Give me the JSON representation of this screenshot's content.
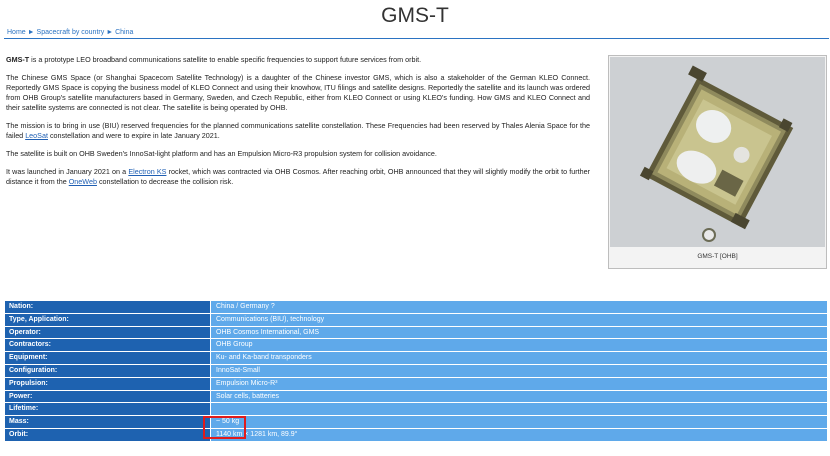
{
  "page": {
    "title": "GMS-T",
    "breadcrumb": [
      "Home",
      "Spacecraft by country",
      "China"
    ],
    "breadcrumb_separator": "►"
  },
  "intro": {
    "p1_bold": "GMS-T",
    "p1_rest": " is a prototype LEO broadband communications satellite to enable specific frequencies to support future services from orbit.",
    "p2": "The Chinese GMS Space (or Shanghai Spacecom Satellite Technology) is a daughter of the Chinese investor GMS, which is also a stakeholder of the German KLEO Connect. Reportedly GMS Space is copying the business model of KLEO Connect and using their knowhow, ITU filings and satellite designs. Reportedly the satellite and its launch was ordered from OHB Group's satellite manufacturers based in Germany, Sweden, and Czech Republic, either from KLEO Connect or using KLEO's funding. How GMS and KLEO Connect and their satellite systems are connected is not clear. The satellite is being operated by OHB.",
    "p3_a": "The mission is to bring in use (BIU) reserved frequencies for the planned communications satellite constellation. These Frequencies had been reserved by Thales Alenia Space for the failed ",
    "p3_link": "LeoSat",
    "p3_b": " constellation and were to expire in late January 2021.",
    "p4": "The satellite is built on OHB Sweden's InnoSat-light platform and has an Empulsion Micro-R3 propulsion system for collision avoidance.",
    "p5_a": "It was launched in January 2021 on a ",
    "p5_link1": "Electron KS",
    "p5_b": " rocket, which was contracted via OHB Cosmos. After reaching orbit, OHB announced that they will slightly modify the orbit to further distance it from the ",
    "p5_link2": "OneWeb",
    "p5_c": " constellation to decrease the collision risk."
  },
  "figure": {
    "caption": "GMS-T [OHB]"
  },
  "specs": [
    {
      "label": "Nation:",
      "value": "China / Germany ?"
    },
    {
      "label": "Type, Application:",
      "value": "Communications (BIU), technology"
    },
    {
      "label": "Operator:",
      "value": "OHB Cosmos International, GMS"
    },
    {
      "label": "Contractors:",
      "value": "OHB Group"
    },
    {
      "label": "Equipment:",
      "value": "Ku- and Ka-band transponders"
    },
    {
      "label": "Configuration:",
      "value": "InnoSat-Small"
    },
    {
      "label": "Propulsion:",
      "value": "Empulsion Micro-R³"
    },
    {
      "label": "Power:",
      "value": "Solar cells, batteries"
    },
    {
      "label": "Lifetime:",
      "value": ""
    },
    {
      "label": "Mass:",
      "value": "~ 50 kg"
    },
    {
      "label": "Orbit:",
      "value": "1140 km × 1281 km, 89.9°"
    }
  ]
}
